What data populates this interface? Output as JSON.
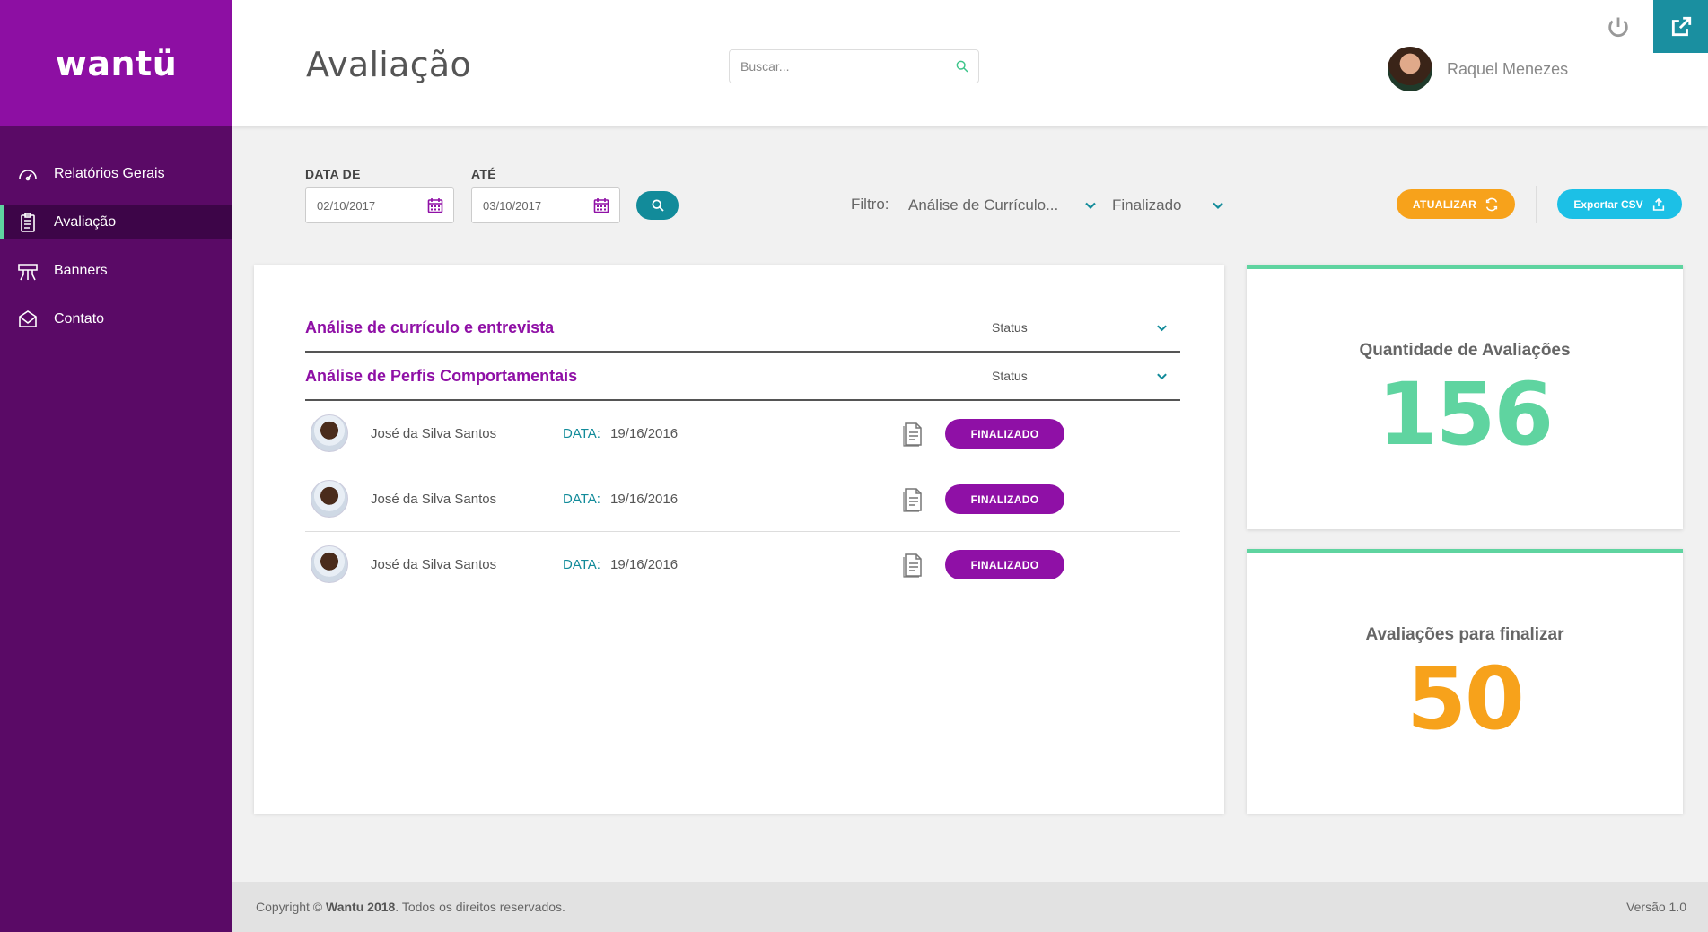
{
  "brand": {
    "logo_text": "wantü"
  },
  "sidebar": {
    "items": [
      {
        "label": "Relatórios Gerais",
        "icon": "gauge-icon",
        "active": false
      },
      {
        "label": "Avaliação",
        "icon": "clipboard-icon",
        "active": true
      },
      {
        "label": "Banners",
        "icon": "banner-icon",
        "active": false
      },
      {
        "label": "Contato",
        "icon": "envelope-icon",
        "active": false
      }
    ]
  },
  "header": {
    "title": "Avaliação",
    "search_placeholder": "Buscar...",
    "user_name": "Raquel Menezes"
  },
  "filters": {
    "date_from_label": "DATA DE",
    "date_from_value": "02/10/2017",
    "date_to_label": "ATÉ",
    "date_to_value": "03/10/2017",
    "filter_label": "Filtro:",
    "filter_type_value": "Análise de Currículo...",
    "filter_status_value": "Finalizado",
    "update_label": "ATUALIZAR",
    "export_label": "Exportar CSV"
  },
  "groups": [
    {
      "title": "Análise de currículo e entrevista",
      "status_label": "Status"
    },
    {
      "title": "Análise de Perfis Comportamentais",
      "status_label": "Status"
    }
  ],
  "rows": [
    {
      "name": "José da Silva Santos",
      "date_label": "DATA:",
      "date": "19/16/2016",
      "status": "FINALIZADO"
    },
    {
      "name": "José da Silva Santos",
      "date_label": "DATA:",
      "date": "19/16/2016",
      "status": "FINALIZADO"
    },
    {
      "name": "José da Silva Santos",
      "date_label": "DATA:",
      "date": "19/16/2016",
      "status": "FINALIZADO"
    }
  ],
  "stats": [
    {
      "label": "Quantidade de Avaliações",
      "value": "156",
      "color": "#5fd4a0"
    },
    {
      "label": "Avaliações para finalizar",
      "value": "50",
      "color": "#f7a21b"
    }
  ],
  "footer": {
    "copyright_prefix": "Copyright ©",
    "copyright_brand": "Wantu 2018",
    "copyright_suffix": ". Todos os direitos reservados.",
    "version": "Versão 1.0"
  },
  "colors": {
    "sidebar": "#5a0a66",
    "logo_bg": "#8d0fa3",
    "accent_purple": "#8f10a6",
    "teal": "#128b9a",
    "green": "#5fd4a0",
    "orange": "#f7a21b",
    "cyan": "#1cc0e6"
  }
}
